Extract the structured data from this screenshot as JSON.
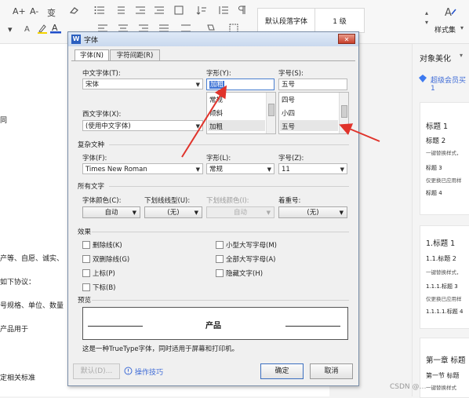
{
  "toolbar": {
    "row1_icons": [
      "A+",
      "A-",
      "变",
      "clear-format",
      "list-bullet",
      "list-number",
      "indent-dec",
      "indent-inc",
      "sort",
      "line-spacing"
    ],
    "row2_icons": [
      "A",
      "ab",
      "A"
    ],
    "style_normal": "默认段落字体",
    "style_heading": "1 级",
    "style_set_label": "样式集",
    "style_set_arrow": "▾",
    "colors": {
      "font_color": "#1f4ec9",
      "highlight": "#f5d400"
    }
  },
  "document": {
    "lines": [
      "同",
      "产等、自愿、诚实、",
      "如下协议：",
      "号规格、单位、数量",
      "产品用于",
      "定相关标准"
    ]
  },
  "right_panel": {
    "header": "对象美化",
    "vip_text": "超级会员买1",
    "card1": {
      "h1": "标题 1",
      "h2": "标题 2",
      "body": "一键替换样式，",
      "h3": "标题 3",
      "body2": "仅更换已应用样",
      "h4": "标题 4"
    },
    "card2": {
      "h1": "1.标题 1",
      "h2": "1.1.标题 2",
      "body": "一键替换样式，",
      "h3": "1.1.1.标题 3",
      "body2": "仅更换已应用样",
      "h4": "1.1.1.1.标题 4"
    },
    "card3": {
      "h1": "第一章  标题",
      "h2": "第一节  标题",
      "body": "一键替换样式"
    }
  },
  "watermark": "CSDN @…",
  "dialog": {
    "title": "字体",
    "app_badge": "W",
    "close": "✕",
    "tabs": [
      "字体(N)",
      "字符间距(R)"
    ],
    "chinese_font_label": "中文字体(T):",
    "chinese_font_value": "宋体",
    "style_label": "字形(Y):",
    "style_value": "加粗",
    "style_list": [
      "常规",
      "倾斜",
      "加粗"
    ],
    "size_label": "字号(S):",
    "size_value": "五号",
    "size_list": [
      "四号",
      "小四",
      "五号"
    ],
    "western_font_label": "西文字体(X):",
    "western_font_value": "(使用中文字体)",
    "complex_section": "复杂文种",
    "complex_font_label": "字体(F):",
    "complex_font_value": "Times New Roman",
    "complex_style_label": "字形(L):",
    "complex_style_value": "常规",
    "complex_size_label": "字号(Z):",
    "complex_size_value": "11",
    "all_text_section": "所有文字",
    "font_color_label": "字体颜色(C):",
    "font_color_value": "自动",
    "underline_type_label": "下划线线型(U):",
    "underline_type_value": "(无)",
    "underline_color_label": "下划线颜色(I):",
    "underline_color_value": "自动",
    "emphasis_label": "着重号:",
    "emphasis_value": "(无)",
    "effects_section": "效果",
    "effects_left": [
      "删除线(K)",
      "双删除线(G)",
      "上标(P)",
      "下标(B)"
    ],
    "effects_right": [
      "小型大写字母(M)",
      "全部大写字母(A)",
      "隐藏文字(H)"
    ],
    "preview_section": "预览",
    "preview_text": "产品",
    "preview_note": "这是一种TrueType字体，同时适用于屏幕和打印机。",
    "default_button": "默认(D)...",
    "tips_link": "操作技巧",
    "ok_button": "确定",
    "cancel_button": "取消"
  }
}
